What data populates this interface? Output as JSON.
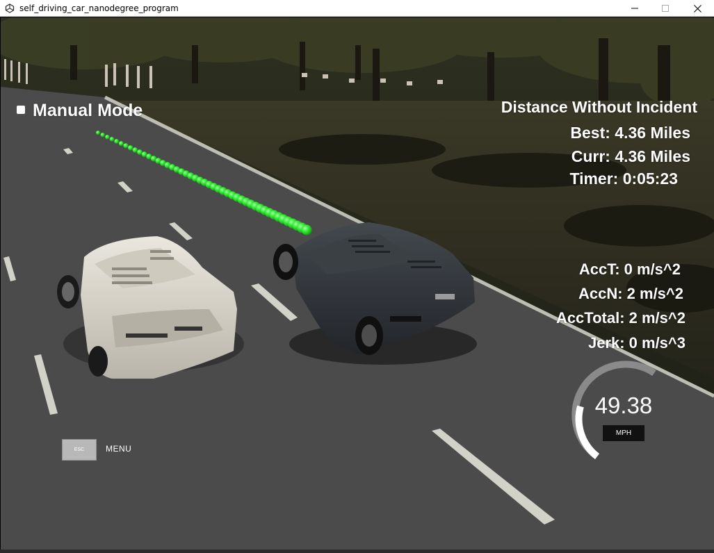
{
  "window": {
    "title": "self_driving_car_nanodegree_program"
  },
  "hud": {
    "mode_label": "Manual Mode",
    "distance_title": "Distance Without Incident",
    "best": "Best: 4.36 Miles",
    "curr": "Curr: 4.36 Miles",
    "timer": "Timer: 0:05:23",
    "acc_t": "AccT: 0 m/s^2",
    "acc_n": "AccN: 2 m/s^2",
    "acc_total": "AccTotal: 2 m/s^2",
    "jerk": "Jerk: 0 m/s^3"
  },
  "speedometer": {
    "value": "49.38",
    "unit": "MPH"
  },
  "menu": {
    "esc_label": "ESC",
    "menu_label": "MENU"
  },
  "colors": {
    "path_green": "#2ee62e",
    "road": "#4a4a4a",
    "grass": "#2c2c20",
    "white_car": "#d9d6cc",
    "dark_car": "#2e3236"
  }
}
